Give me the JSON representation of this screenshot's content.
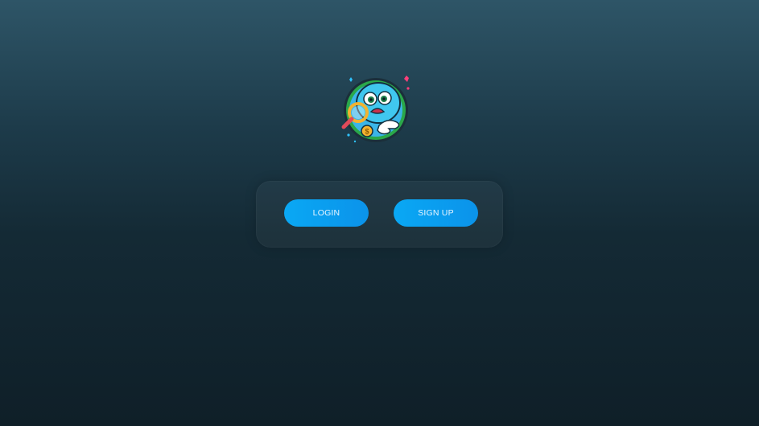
{
  "logo": {
    "icon": "magnifying-glass-mascot-icon"
  },
  "auth": {
    "login_label": "LOGIN",
    "signup_label": "SIGN UP"
  },
  "colors": {
    "button": "#0aa8f4",
    "background_top": "#2e5567",
    "background_bottom": "#0f1f28"
  }
}
